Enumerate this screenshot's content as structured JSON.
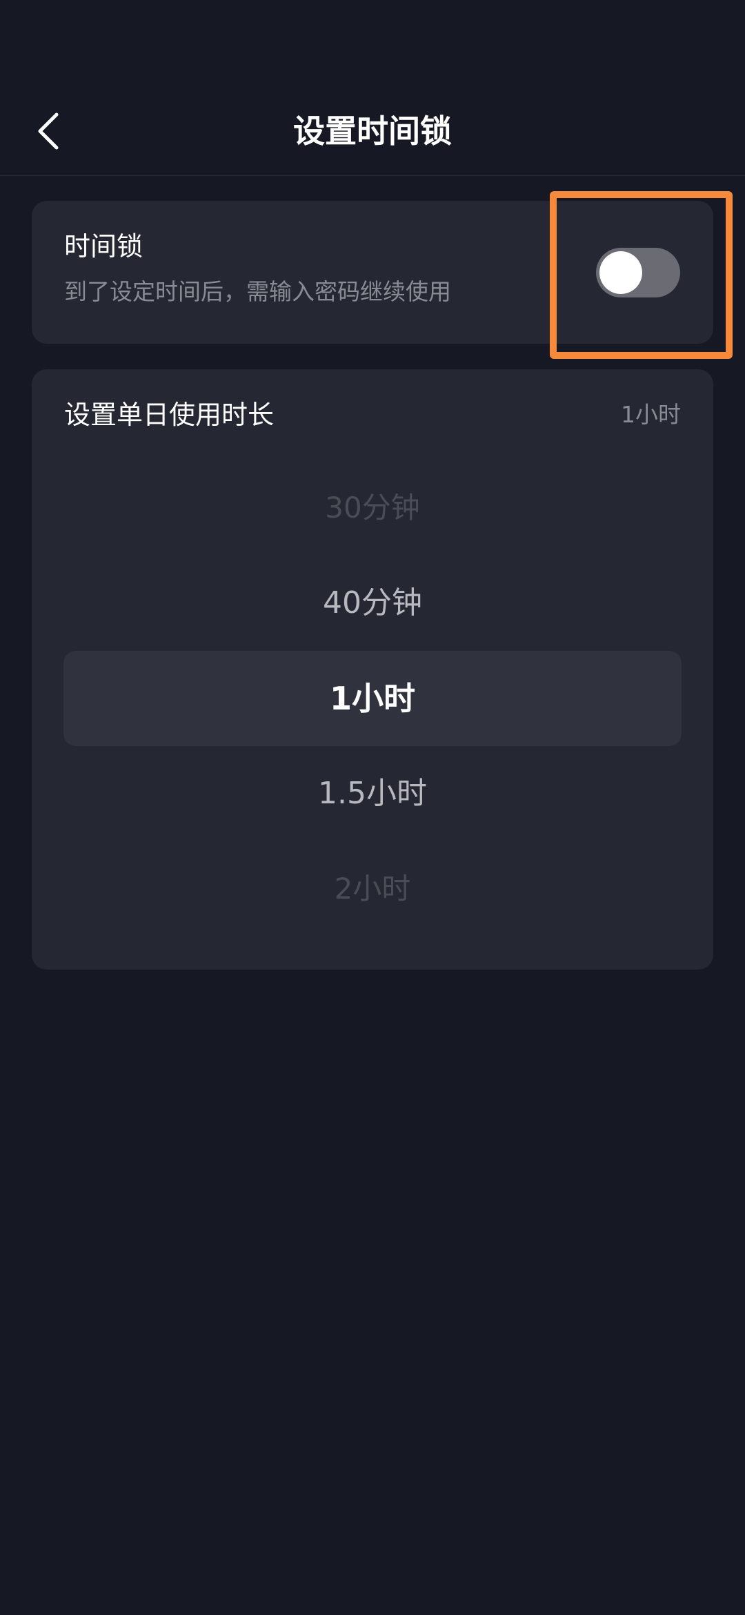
{
  "header": {
    "title": "设置时间锁",
    "back_icon": "chevron-left-icon"
  },
  "time_lock": {
    "title": "时间锁",
    "description": "到了设定时间后，需输入密码继续使用",
    "toggle_on": false
  },
  "duration": {
    "title": "设置单日使用时长",
    "current_value": "1小时",
    "options": [
      "30分钟",
      "40分钟",
      "1小时",
      "1.5小时",
      "2小时"
    ],
    "selected_index": 2
  },
  "colors": {
    "background": "#161823",
    "card": "#252732",
    "highlight": "#f6893a",
    "toggle_off": "#6b6c73"
  }
}
